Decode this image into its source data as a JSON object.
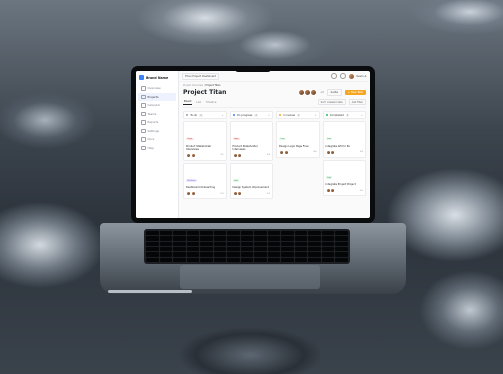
{
  "sidebar": {
    "brand": "Brand Name",
    "items": [
      {
        "label": "Overview",
        "active": false
      },
      {
        "label": "Projects",
        "active": true
      },
      {
        "label": "Calendar",
        "active": false
      },
      {
        "label": "Teams",
        "active": false
      },
      {
        "label": "Reports",
        "active": false
      },
      {
        "label": "Settings",
        "active": false
      },
      {
        "label": "Docs",
        "active": false
      },
      {
        "label": "Help",
        "active": false
      }
    ]
  },
  "topbar": {
    "tab": "Titan Project Dashboard",
    "user": "Kevin A."
  },
  "page": {
    "breadcrumb_root": "Project Overview",
    "breadcrumb_current": "Project Titan",
    "title": "Project Titan",
    "avatar_extra": "+3",
    "invite": "Invite",
    "new_task": "+ New Task"
  },
  "viewbar": {
    "tabs": [
      "Board",
      "List",
      "Timeline"
    ],
    "filter": "Sort: Created date",
    "add_filter": "Add Filter"
  },
  "columns": [
    {
      "name": "To-do",
      "count": "4",
      "color": "#9aa0a8",
      "cards": [
        {
          "tag": "High",
          "tag_color": "#fde2e2",
          "tag_text": "#d64545",
          "title": "Product Stakeholder Interviews",
          "desc": "",
          "meta": "2/5"
        },
        {
          "tag": "Medium",
          "tag_color": "#ede7fb",
          "tag_text": "#7c5cd6",
          "title": "Dashboard Onboarding",
          "desc": "",
          "meta": "1/4"
        }
      ]
    },
    {
      "name": "On progress",
      "count": "3",
      "color": "#3b82f6",
      "cards": [
        {
          "tag": "High",
          "tag_color": "#fde2e2",
          "tag_text": "#d64545",
          "title": "Product Stakeholder Interviews",
          "desc": "",
          "meta": "3/6"
        },
        {
          "tag": "Low",
          "tag_color": "#e2f5e6",
          "tag_text": "#2f9e55",
          "title": "Design System Improvement",
          "desc": "",
          "meta": "2/3"
        }
      ]
    },
    {
      "name": "In review",
      "count": "2",
      "color": "#f5a623",
      "cards": [
        {
          "tag": "Low",
          "tag_color": "#e2f5e6",
          "tag_text": "#2f9e55",
          "title": "Design Login Page Flow",
          "desc": "",
          "meta": "4/4"
        }
      ]
    },
    {
      "name": "Completed",
      "count": "5",
      "color": "#22c55e",
      "cards": [
        {
          "tag": "Low",
          "tag_color": "#e2f5e6",
          "tag_text": "#2f9e55",
          "title": "Integrate API for Pa",
          "desc": "",
          "meta": "6/6"
        },
        {
          "tag": "Low",
          "tag_color": "#e2f5e6",
          "tag_text": "#2f9e55",
          "title": "Integrate Project Project",
          "desc": "",
          "meta": "5/5"
        }
      ]
    }
  ]
}
